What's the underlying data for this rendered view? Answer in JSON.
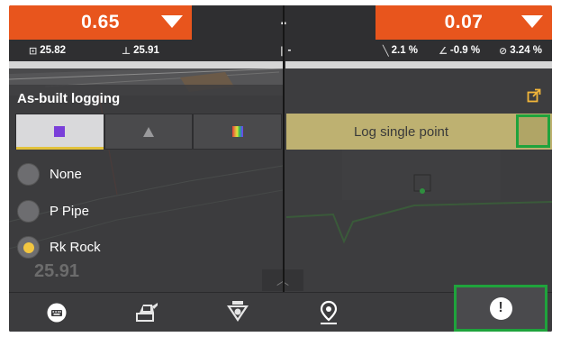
{
  "top_left": {
    "value": "0.65"
  },
  "top_mid": {
    "value": "-"
  },
  "top_right": {
    "value": "0.07"
  },
  "info_left": {
    "item1": "25.82",
    "item2": "25.91"
  },
  "info_mid": {
    "item1": "-"
  },
  "info_right": {
    "item1": "2.1 %",
    "item2": "-0.9 %",
    "item3": "3.24 %"
  },
  "panel": {
    "title": "As-built logging",
    "tabs": [
      {
        "icon": "purple-square-icon",
        "active": true
      },
      {
        "icon": "triangle-icon",
        "active": false
      },
      {
        "icon": "rainbow-icon",
        "active": false
      }
    ],
    "options": [
      {
        "label": "None",
        "selected": false
      },
      {
        "label": "P Pipe",
        "selected": false
      },
      {
        "label": "Rk Rock",
        "selected": true
      }
    ]
  },
  "log_button": {
    "label": "Log single point"
  },
  "background_value": "25.91",
  "colors": {
    "accent_orange": "#e8551d",
    "log_button": "#beb171",
    "highlight_green": "#1fa33c",
    "radio_selected": "#f2c640"
  },
  "bottom_nav": {
    "items": [
      "keyboard-icon",
      "machine-icon",
      "radar-icon",
      "location-pin-icon",
      "alert-icon"
    ]
  }
}
